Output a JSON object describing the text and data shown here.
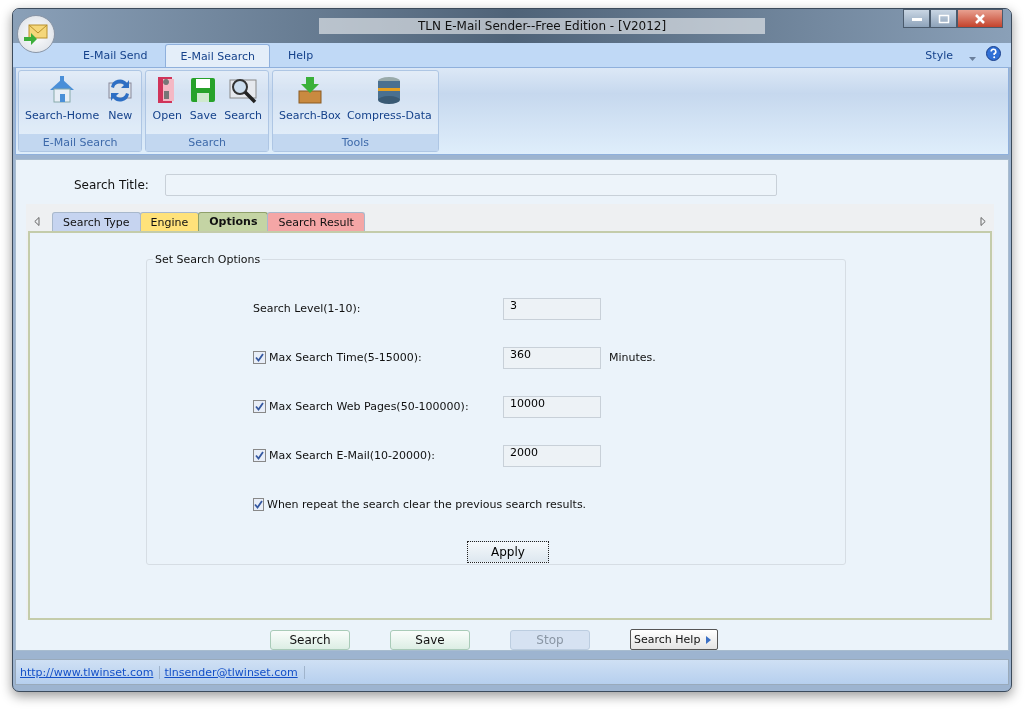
{
  "window": {
    "title": "TLN E-Mail Sender--Free Edition - [V2012]"
  },
  "ribbon_tabs": [
    {
      "label": "E-Mail Send",
      "selected": false
    },
    {
      "label": "E-Mail Search",
      "selected": true
    },
    {
      "label": "Help",
      "selected": false
    }
  ],
  "style_menu": {
    "label": "Style"
  },
  "ribbon_groups": [
    {
      "title": "E-Mail Search",
      "buttons": [
        {
          "label": "Search-Home"
        },
        {
          "label": "New"
        }
      ]
    },
    {
      "title": "Search",
      "buttons": [
        {
          "label": "Open"
        },
        {
          "label": "Save"
        },
        {
          "label": "Search"
        }
      ]
    },
    {
      "title": "Tools",
      "buttons": [
        {
          "label": "Search-Box"
        },
        {
          "label": "Compress-Data"
        }
      ]
    }
  ],
  "search_title": {
    "label": "Search Title:"
  },
  "tabs": [
    {
      "label": "Search Type",
      "color": "#c6d4f0",
      "selected": false
    },
    {
      "label": "Engine",
      "color": "#ffe27a",
      "selected": false
    },
    {
      "label": "Options",
      "color": "#c4d4a4",
      "selected": true
    },
    {
      "label": "Search Result",
      "color": "#f4a6a6",
      "selected": false
    }
  ],
  "options_group": {
    "title": "Set Search Options",
    "rows": [
      {
        "kind": "field",
        "label": "Search Level(1-10):",
        "value": "3"
      },
      {
        "kind": "checkbox-field",
        "label": "Max Search Time(5-15000):",
        "checked": true,
        "value": "360",
        "unit": "Minutes."
      },
      {
        "kind": "checkbox-field",
        "label": "Max Search Web Pages(50-100000):",
        "checked": true,
        "value": "10000"
      },
      {
        "kind": "checkbox-field",
        "label": "Max Search E-Mail(10-20000):",
        "checked": true,
        "value": "2000"
      },
      {
        "kind": "checkbox",
        "label": "When repeat the search clear the previous search results.",
        "checked": true
      }
    ],
    "apply": "Apply"
  },
  "bottom_buttons": [
    {
      "kind": "plain",
      "label": "Search",
      "disabled": false
    },
    {
      "kind": "plain",
      "label": "Save",
      "disabled": false
    },
    {
      "kind": "plain",
      "label": "Stop",
      "disabled": true
    },
    {
      "kind": "split",
      "label": "Search Help",
      "disabled": false
    }
  ],
  "status_bar": [
    {
      "text": "http://www.tlwinset.com"
    },
    {
      "text": "tlnsender@tlwinset.com"
    }
  ]
}
